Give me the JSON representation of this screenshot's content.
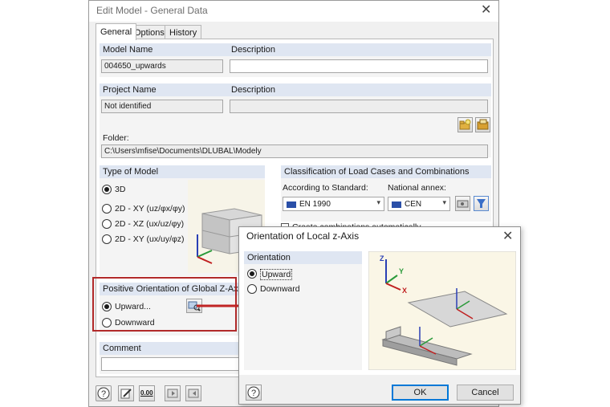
{
  "main_dialog": {
    "title": "Edit Model - General Data",
    "tabs": [
      "General",
      "Options",
      "History"
    ],
    "model_name_label": "Model Name",
    "model_name_value": "004650_upwards",
    "description_label": "Description",
    "description_value": "",
    "project_name_label": "Project Name",
    "project_name_value": "Not identified",
    "project_description_label": "Description",
    "project_description_value": "",
    "folder_label": "Folder:",
    "folder_value": "C:\\Users\\mfise\\Documents\\DLUBAL\\Modely",
    "type_of_model": {
      "label": "Type of Model",
      "options": [
        "3D",
        "2D - XY (uz/φx/φy)",
        "2D - XZ (ux/uz/φy)",
        "2D - XY (ux/uy/φz)"
      ],
      "selected_index": 0
    },
    "classification": {
      "label": "Classification of Load Cases and Combinations",
      "according_label": "According to Standard:",
      "standard_value": "EN 1990",
      "annex_label": "National annex:",
      "annex_value": "CEN",
      "create_combinations_label": "Create combinations automatically"
    },
    "global_z": {
      "label": "Positive Orientation of Global Z-Axis",
      "options": [
        "Upward...",
        "Downward"
      ],
      "selected_index": 0
    },
    "comment_label": "Comment",
    "comment_value": "",
    "bottom_icons": [
      "help-icon",
      "edit-icon",
      "units-icon",
      "import-icon",
      "export-icon"
    ],
    "units_icon_text": "0.00"
  },
  "sub_dialog": {
    "title": "Orientation of Local z-Axis",
    "group_label": "Orientation",
    "options": [
      "Upward",
      "Downward"
    ],
    "selected_index": 0,
    "ok_label": "OK",
    "cancel_label": "Cancel",
    "axis_labels": {
      "z": "Z",
      "y": "Y",
      "x": "X"
    }
  },
  "colors": {
    "highlight_box": "#b22a2a",
    "arrow": "#c02525",
    "group_header": "#dfe6f2",
    "ok_border": "#0078d7"
  }
}
